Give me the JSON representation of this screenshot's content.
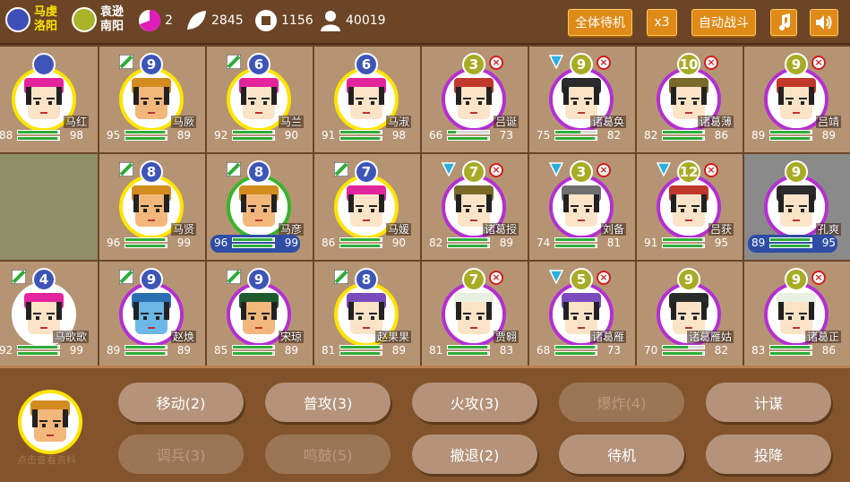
{
  "factions": [
    {
      "ruler": "马虔",
      "city": "洛阳",
      "color": "#3f4fb8"
    },
    {
      "ruler": "袁逊",
      "city": "南阳",
      "color": "#aab42a"
    }
  ],
  "stats": {
    "cities": "2",
    "food": "2845",
    "gold": "1156",
    "troops": "40019"
  },
  "buttons": {
    "all_standby": "全体待机",
    "speed": "x3",
    "auto_battle": "自动战斗"
  },
  "units": [
    {
      "name": "马红",
      "lvl": "",
      "atk": "88",
      "def": "98",
      "hp": 0.95,
      "mp": 0.95,
      "side": "blue",
      "ring": "yellow",
      "hat": "magenta",
      "skin": "#fbe3c7",
      "badge_l": "",
      "badge_r": false,
      "hl": false
    },
    {
      "name": "马厥",
      "lvl": "9",
      "atk": "95",
      "def": "89",
      "hp": 0.95,
      "mp": 0.95,
      "side": "blue",
      "ring": "yellow",
      "hat": "gold",
      "skin": "#f2b77b",
      "badge_l": "leaf",
      "badge_r": false,
      "hl": false
    },
    {
      "name": "马兰",
      "lvl": "6",
      "atk": "92",
      "def": "90",
      "hp": 0.95,
      "mp": 0.95,
      "side": "blue",
      "ring": "yellow",
      "hat": "magenta",
      "skin": "#fbe3c7",
      "badge_l": "leaf",
      "badge_r": false,
      "hl": false
    },
    {
      "name": "马淑",
      "lvl": "6",
      "atk": "91",
      "def": "98",
      "hp": 0.95,
      "mp": 0.95,
      "side": "blue",
      "ring": "yellow",
      "hat": "magenta",
      "skin": "#fbe3c7",
      "badge_l": "",
      "badge_r": false,
      "hl": false
    },
    {
      "name": "吕诞",
      "lvl": "3",
      "atk": "66",
      "def": "73",
      "hp": 0.2,
      "mp": 0.95,
      "side": "olive",
      "ring": "purple",
      "hat": "red",
      "skin": "#fbe3c7",
      "badge_l": "",
      "badge_r": true,
      "hl": false
    },
    {
      "name": "诸葛奂",
      "lvl": "9",
      "atk": "75",
      "def": "82",
      "hp": 0.6,
      "mp": 0.95,
      "side": "olive",
      "ring": "purple",
      "hat": "black",
      "skin": "#fbe3c7",
      "badge_l": "shield",
      "badge_r": true,
      "hl": false
    },
    {
      "name": "诸葛薄",
      "lvl": "10",
      "atk": "82",
      "def": "86",
      "hp": 0.95,
      "mp": 0.95,
      "side": "olive",
      "ring": "purple",
      "hat": "olive",
      "skin": "#fbe3c7",
      "badge_l": "",
      "badge_r": true,
      "hl": false
    },
    {
      "name": "吕靖",
      "lvl": "9",
      "atk": "89",
      "def": "89",
      "hp": 0.95,
      "mp": 0.95,
      "side": "olive",
      "ring": "purple",
      "hat": "red",
      "skin": "#fbe3c7",
      "badge_l": "",
      "badge_r": true,
      "hl": false
    },
    {
      "name": "",
      "empty": true
    },
    {
      "name": "马贤",
      "lvl": "8",
      "atk": "96",
      "def": "99",
      "hp": 0.95,
      "mp": 0.95,
      "side": "blue",
      "ring": "yellow",
      "hat": "gold",
      "skin": "#f2b77b",
      "badge_l": "leaf",
      "badge_r": false,
      "hl": false
    },
    {
      "name": "马彦",
      "lvl": "8",
      "atk": "96",
      "def": "99",
      "hp": 0.95,
      "mp": 0.95,
      "side": "blue",
      "ring": "green",
      "hat": "gold",
      "skin": "#f2b77b",
      "badge_l": "leaf",
      "badge_r": false,
      "hl": true
    },
    {
      "name": "马媛",
      "lvl": "7",
      "atk": "86",
      "def": "90",
      "hp": 0.95,
      "mp": 0.95,
      "side": "blue",
      "ring": "yellow",
      "hat": "magenta",
      "skin": "#fbe3c7",
      "badge_l": "leaf",
      "badge_r": false,
      "hl": false
    },
    {
      "name": "诸葛授",
      "lvl": "7",
      "atk": "82",
      "def": "89",
      "hp": 0.95,
      "mp": 0.95,
      "side": "olive",
      "ring": "purple",
      "hat": "olive",
      "skin": "#fbe3c7",
      "badge_l": "shield",
      "badge_r": true,
      "hl": false
    },
    {
      "name": "刘备",
      "lvl": "3",
      "atk": "74",
      "def": "81",
      "hp": 0.95,
      "mp": 0.95,
      "side": "olive",
      "ring": "grey",
      "hat": "grey",
      "skin": "#fbe3c7",
      "badge_l": "shield",
      "badge_r": true,
      "hl": false
    },
    {
      "name": "吕获",
      "lvl": "12",
      "atk": "91",
      "def": "95",
      "hp": 0.95,
      "mp": 0.95,
      "side": "olive",
      "ring": "purple",
      "hat": "red",
      "skin": "#fbe3c7",
      "badge_l": "shield",
      "badge_r": true,
      "hl": false
    },
    {
      "name": "孔爽",
      "lvl": "9",
      "atk": "89",
      "def": "95",
      "hp": 0.95,
      "mp": 0.95,
      "side": "olive",
      "ring": "purple",
      "hat": "black",
      "skin": "#fbe3c7",
      "badge_l": "",
      "badge_r": false,
      "hl": true,
      "dark": true
    },
    {
      "name": "马歌歌",
      "lvl": "4",
      "atk": "92",
      "def": "99",
      "hp": 0.95,
      "mp": 0.95,
      "side": "blue",
      "ring": "white",
      "hat": "magenta",
      "skin": "#fbe3c7",
      "badge_l": "leaf",
      "badge_r": false,
      "hl": false
    },
    {
      "name": "赵焕",
      "lvl": "9",
      "atk": "89",
      "def": "89",
      "hp": 0.95,
      "mp": 0.95,
      "side": "blue",
      "ring": "purple",
      "hat": "blue",
      "skin": "#6bb7e6",
      "badge_l": "leaf",
      "badge_r": false,
      "hl": false
    },
    {
      "name": "宋琼",
      "lvl": "9",
      "atk": "85",
      "def": "89",
      "hp": 0.95,
      "mp": 0.95,
      "side": "blue",
      "ring": "purple",
      "hat": "darkgreen",
      "skin": "#f2b77b",
      "badge_l": "leaf",
      "badge_r": false,
      "hl": false
    },
    {
      "name": "赵果果",
      "lvl": "8",
      "atk": "81",
      "def": "89",
      "hp": 0.95,
      "mp": 0.95,
      "side": "blue",
      "ring": "yellow",
      "hat": "purple",
      "skin": "#fbe3c7",
      "badge_l": "leaf",
      "badge_r": false,
      "hl": false
    },
    {
      "name": "贾翱",
      "lvl": "7",
      "atk": "81",
      "def": "83",
      "hp": 0.95,
      "mp": 0.95,
      "side": "olive",
      "ring": "purple",
      "hat": "white",
      "skin": "#fbe3c7",
      "badge_l": "",
      "badge_r": true,
      "hl": false
    },
    {
      "name": "诸葛雁",
      "lvl": "5",
      "atk": "68",
      "def": "73",
      "hp": 0.95,
      "mp": 0.95,
      "side": "olive",
      "ring": "purple",
      "hat": "purple",
      "skin": "#fbe3c7",
      "badge_l": "shield",
      "badge_r": true,
      "hl": false
    },
    {
      "name": "诸葛雁姑",
      "lvl": "9",
      "atk": "70",
      "def": "82",
      "hp": 0.6,
      "mp": 0.95,
      "side": "olive",
      "ring": "purple",
      "hat": "black",
      "skin": "#fbe3c7",
      "badge_l": "",
      "badge_r": false,
      "hl": false
    },
    {
      "name": "诸葛正",
      "lvl": "9",
      "atk": "83",
      "def": "86",
      "hp": 0.95,
      "mp": 0.95,
      "side": "olive",
      "ring": "purple",
      "hat": "white",
      "skin": "#fbe3c7",
      "badge_l": "",
      "badge_r": true,
      "hl": false
    }
  ],
  "actions": [
    {
      "label": "移动(2)",
      "enabled": true
    },
    {
      "label": "普攻(3)",
      "enabled": true
    },
    {
      "label": "火攻(3)",
      "enabled": true
    },
    {
      "label": "爆炸(4)",
      "enabled": false
    },
    {
      "label": "计谋",
      "enabled": true
    },
    {
      "label": "调兵(3)",
      "enabled": false
    },
    {
      "label": "鸣鼓(5)",
      "enabled": false
    },
    {
      "label": "撤退(2)",
      "enabled": true
    },
    {
      "label": "待机",
      "enabled": true
    },
    {
      "label": "投降",
      "enabled": true
    }
  ],
  "selected": {
    "hint": "点击查看资料"
  }
}
